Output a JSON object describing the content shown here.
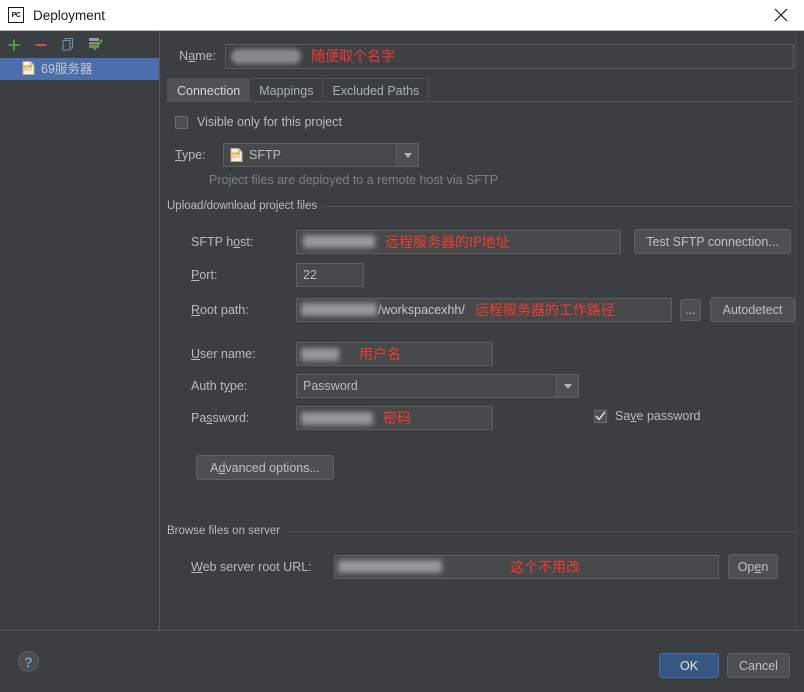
{
  "window": {
    "title": "Deployment",
    "app_icon": "pycharm-icon",
    "close_label": "✕"
  },
  "sidebar": {
    "toolbar": [
      {
        "name": "add-button",
        "icon": "plus-icon",
        "color": "#4a9b4a"
      },
      {
        "name": "remove-button",
        "icon": "minus-icon",
        "color": "#c75450"
      },
      {
        "name": "copy-button",
        "icon": "copy-icon",
        "color": "#6897bb"
      },
      {
        "name": "set-default-button",
        "icon": "checkmark-server-icon",
        "color": "#5a9e3f"
      }
    ],
    "items": [
      {
        "label": "69服务器",
        "icon": "sftp-file-icon",
        "selected": true
      }
    ]
  },
  "form": {
    "name_label": "Name:",
    "name_value": "",
    "name_annotation": "随便取个名字",
    "tabs": [
      {
        "label": "Connection",
        "active": true
      },
      {
        "label": "Mappings",
        "active": false
      },
      {
        "label": "Excluded Paths",
        "active": false
      }
    ],
    "visible_only_checkbox": {
      "label": "Visible only for this project",
      "checked": false
    },
    "type_label": "Type:",
    "type_value": "SFTP",
    "type_icon": "sftp-file-icon",
    "type_hint": "Project files are deployed to a remote host via SFTP",
    "upload_group_title": "Upload/download project files",
    "sftp_host_label": "SFTP host:",
    "sftp_host_value": "",
    "sftp_host_annotation": "远程服务器的IP地址",
    "test_connection_label": "Test SFTP connection...",
    "port_label": "Port:",
    "port_value": "22",
    "root_path_label": "Root path:",
    "root_path_value": "/workspacexhh/",
    "root_path_annotation": "远程服务器的工作路径",
    "browse_button_label": "...",
    "autodetect_label": "Autodetect",
    "user_name_label": "User name:",
    "user_name_value": "",
    "user_name_annotation": "用户名",
    "auth_type_label": "Auth type:",
    "auth_type_value": "Password",
    "password_label": "Password:",
    "password_value": "",
    "password_annotation": "密码",
    "save_password": {
      "label": "Save password",
      "checked": true
    },
    "advanced_options_label": "Advanced options...",
    "browse_group_title": "Browse files on server",
    "web_root_label": "Web server root URL:",
    "web_root_value": "",
    "web_root_annotation": "这个不用改",
    "open_label": "Open"
  },
  "footer": {
    "help_label": "?",
    "ok_label": "OK",
    "cancel_label": "Cancel"
  },
  "colors": {
    "background": "#3c3f41",
    "selection": "#4b6eaf",
    "accent_ok": "#365880",
    "annotation": "#f23a33",
    "text": "#bbbbbb"
  }
}
